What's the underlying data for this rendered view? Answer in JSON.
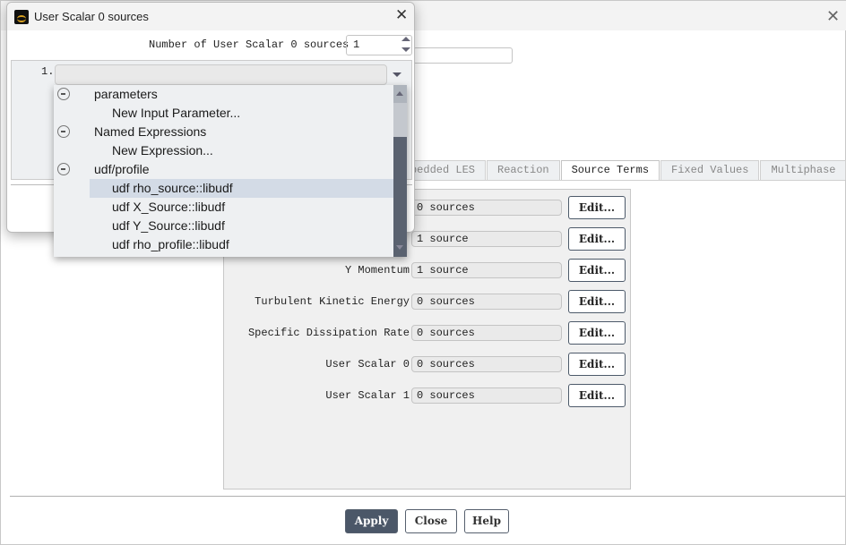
{
  "background_window": {
    "close_icon": "close-icon",
    "tabs": [
      "Embedded LES",
      "Reaction",
      "Source Terms",
      "Fixed Values",
      "Multiphase"
    ],
    "active_tab": "Source Terms",
    "source_rows": [
      {
        "label": "",
        "value": "0 sources",
        "button": "Edit..."
      },
      {
        "label": "",
        "value": "1 source",
        "button": "Edit..."
      },
      {
        "label": "Y Momentum",
        "value": "1 source",
        "button": "Edit..."
      },
      {
        "label": "Turbulent Kinetic Energy",
        "value": "0 sources",
        "button": "Edit..."
      },
      {
        "label": "Specific Dissipation Rate",
        "value": "0 sources",
        "button": "Edit..."
      },
      {
        "label": "User Scalar 0",
        "value": "0 sources",
        "button": "Edit..."
      },
      {
        "label": "User Scalar 1",
        "value": "0 sources",
        "button": "Edit..."
      }
    ],
    "buttons": {
      "apply": "Apply",
      "close": "Close",
      "help": "Help"
    }
  },
  "dialog": {
    "title": "User Scalar 0 sources",
    "number_label": "Number of User Scalar 0 sources",
    "number_value": "1",
    "index_label": "1.",
    "combo_value": "",
    "dropdown_items": [
      {
        "text": "parameters",
        "level": 0,
        "collapsible": true
      },
      {
        "text": "New Input Parameter...",
        "level": 1
      },
      {
        "text": "Named Expressions",
        "level": 0,
        "collapsible": true
      },
      {
        "text": "New Expression...",
        "level": 1
      },
      {
        "text": "udf/profile",
        "level": 0,
        "collapsible": true
      },
      {
        "text": "udf rho_source::libudf",
        "level": 1,
        "highlighted": true
      },
      {
        "text": "udf X_Source::libudf",
        "level": 1
      },
      {
        "text": "udf Y_Source::libudf",
        "level": 1
      },
      {
        "text": "udf rho_profile::libudf",
        "level": 1
      }
    ]
  },
  "colors": {
    "apply_button": "#4b5768",
    "highlight": "#d3dbe6",
    "scrollbar": "#5a6270"
  }
}
